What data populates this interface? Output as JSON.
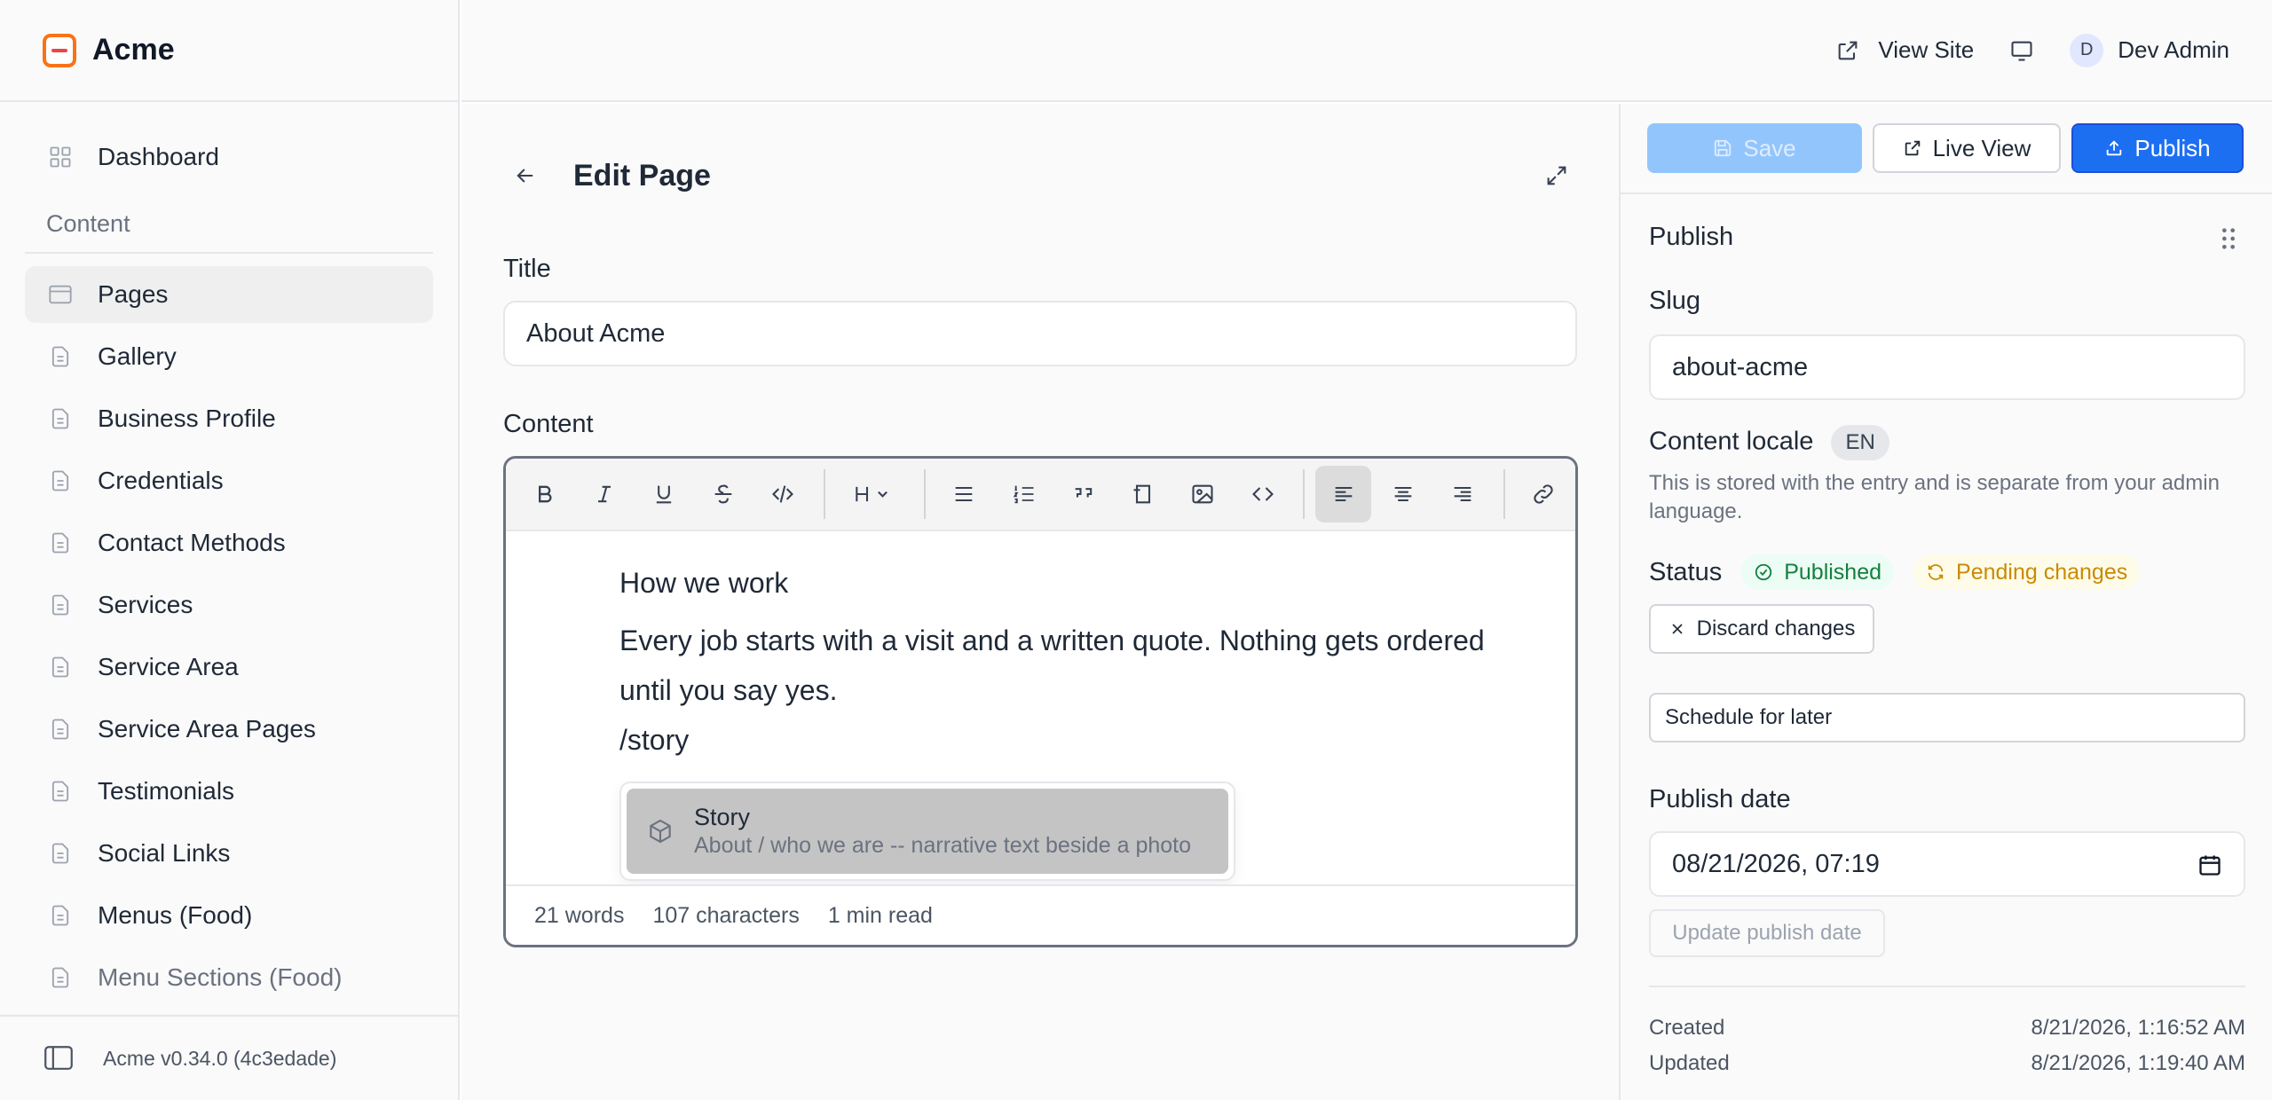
{
  "brand": {
    "name": "Acme"
  },
  "topbar": {
    "view_site": "View Site",
    "user_initial": "D",
    "user_name": "Dev Admin"
  },
  "sidebar": {
    "dashboard": "Dashboard",
    "section": "Content",
    "items": [
      {
        "label": "Pages",
        "active": true
      },
      {
        "label": "Gallery"
      },
      {
        "label": "Business Profile"
      },
      {
        "label": "Credentials"
      },
      {
        "label": "Contact Methods"
      },
      {
        "label": "Services"
      },
      {
        "label": "Service Area"
      },
      {
        "label": "Service Area Pages"
      },
      {
        "label": "Testimonials"
      },
      {
        "label": "Social Links"
      },
      {
        "label": "Menus (Food)"
      },
      {
        "label": "Menu Sections (Food)"
      }
    ],
    "version": "Acme v0.34.0 (4c3edade)"
  },
  "editor": {
    "page_title": "Edit Page",
    "title_label": "Title",
    "title_value": "About Acme",
    "content_label": "Content",
    "heading": "How we work",
    "paragraph": "Every job starts with a visit and a written quote. Nothing gets ordered until you say yes.",
    "command": "/story",
    "slash_menu": {
      "title": "Story",
      "description": "About / who we are -- narrative text beside a photo"
    },
    "stats": {
      "words": "21 words",
      "characters": "107 characters",
      "read_time": "1 min read"
    }
  },
  "panel": {
    "save": "Save",
    "live_view": "Live View",
    "publish": "Publish",
    "section_title": "Publish",
    "slug_label": "Slug",
    "slug_value": "about-acme",
    "locale_label": "Content locale",
    "locale_value": "EN",
    "locale_help": "This is stored with the entry and is separate from your admin language.",
    "status_label": "Status",
    "status_published": "Published",
    "status_pending": "Pending changes",
    "discard": "Discard changes",
    "schedule": "Schedule for later",
    "publish_date_label": "Publish date",
    "publish_date_value": "08/21/2026, 07:19",
    "update_date": "Update publish date",
    "created_label": "Created",
    "created_value": "8/21/2026, 1:16:52 AM",
    "updated_label": "Updated",
    "updated_value": "8/21/2026, 1:19:40 AM"
  },
  "colors": {
    "accent": "#1d6ff2",
    "brand": "#f97316",
    "published": "#15803d",
    "pending": "#ca8a04"
  }
}
